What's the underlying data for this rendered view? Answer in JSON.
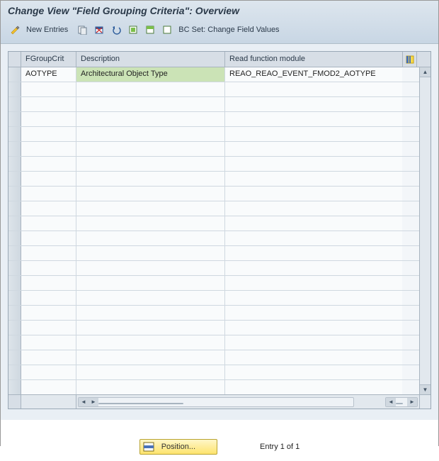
{
  "header": {
    "title": "Change View \"Field Grouping Criteria\": Overview"
  },
  "toolbar": {
    "new_entries_label": "New Entries",
    "bcset_label": "BC Set: Change Field Values"
  },
  "table": {
    "columns": {
      "c1": "FGroupCrit",
      "c2": "Description",
      "c3": "Read function module"
    },
    "rows": [
      {
        "c1": "AOTYPE",
        "c2": "Architectural Object Type",
        "c3": "REAO_REAO_EVENT_FMOD2_AOTYPE"
      }
    ],
    "empty_rows": 21
  },
  "footer": {
    "position_label": "Position...",
    "entry_text": "Entry 1 of 1"
  }
}
